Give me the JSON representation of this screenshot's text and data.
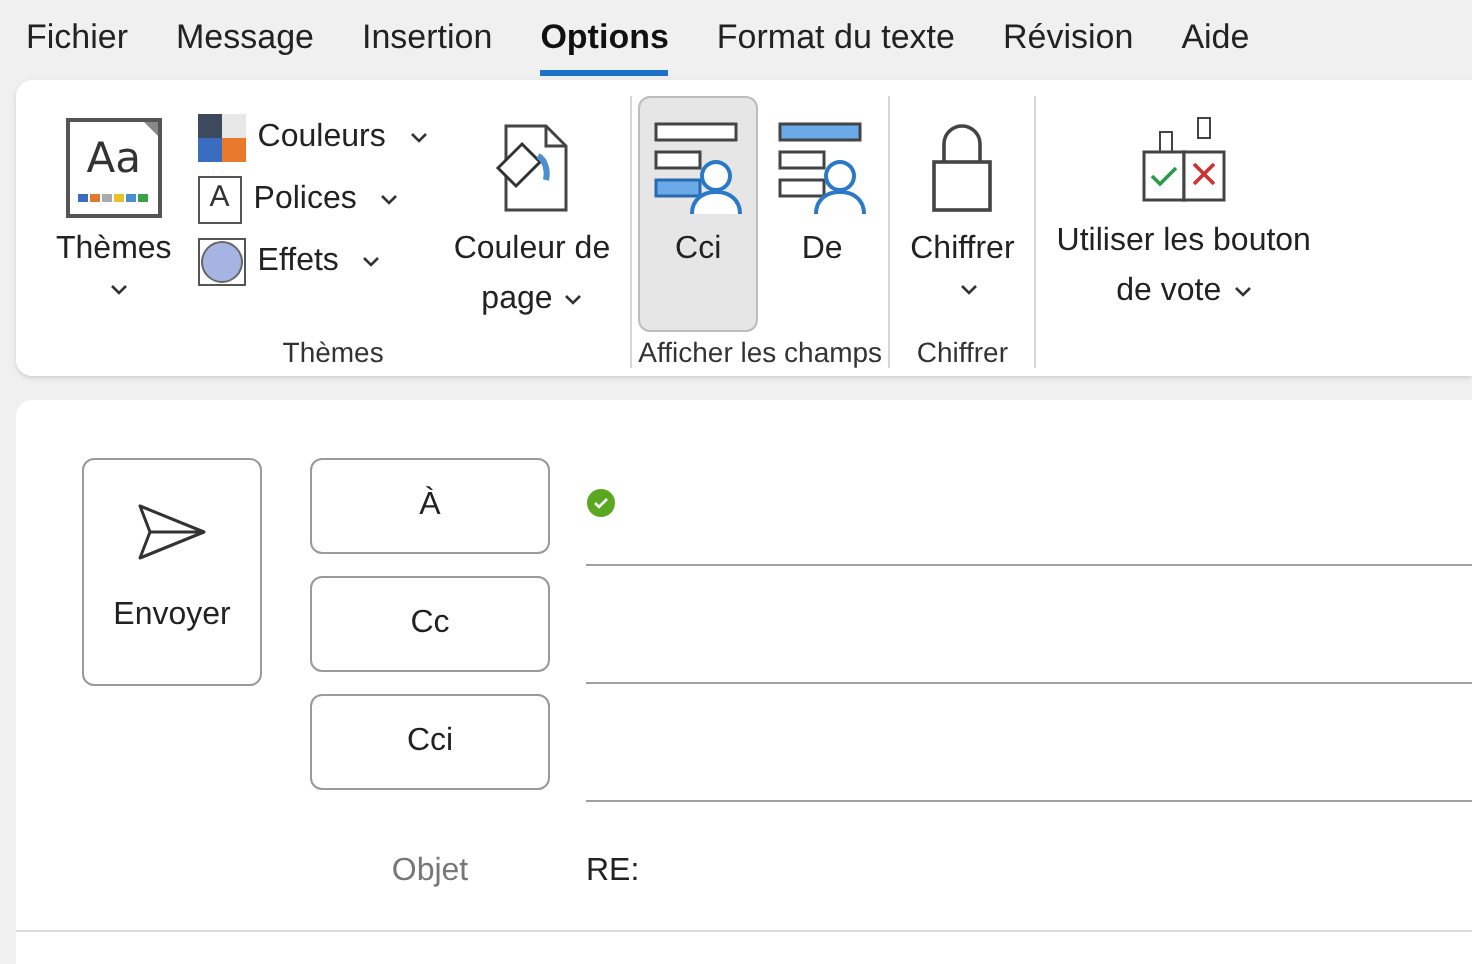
{
  "menu_tabs": [
    {
      "label": "Fichier",
      "selected": false
    },
    {
      "label": "Message",
      "selected": false
    },
    {
      "label": "Insertion",
      "selected": false
    },
    {
      "label": "Options",
      "selected": true
    },
    {
      "label": "Format du texte",
      "selected": false
    },
    {
      "label": "Révision",
      "selected": false
    },
    {
      "label": "Aide",
      "selected": false
    }
  ],
  "ribbon": {
    "groups": [
      {
        "label": "Thèmes",
        "items": [
          {
            "kind": "large",
            "icon_text": "Aa",
            "lines": [
              "Thèmes"
            ],
            "dropdown": true,
            "selected": false
          },
          {
            "kind": "stack",
            "entries": [
              {
                "label": "Couleurs",
                "dropdown": true
              },
              {
                "icon_text": "A",
                "label": "Polices",
                "dropdown": true
              },
              {
                "label": "Effets",
                "dropdown": true
              }
            ]
          },
          {
            "kind": "large",
            "lines": [
              "Couleur de",
              "page"
            ],
            "dropdown": true,
            "selected": false
          }
        ]
      },
      {
        "label": "Afficher les champs",
        "items": [
          {
            "kind": "large",
            "lines": [
              "Cci"
            ],
            "dropdown": false,
            "selected": true
          },
          {
            "kind": "large",
            "lines": [
              "De"
            ],
            "dropdown": false,
            "selected": false
          }
        ]
      },
      {
        "label": "Chiffrer",
        "items": [
          {
            "kind": "large",
            "lines": [
              "Chiffrer"
            ],
            "dropdown": true,
            "selected": false
          }
        ]
      },
      {
        "items": [
          {
            "kind": "large",
            "lines": [
              "Utiliser les bouton",
              "de vote"
            ],
            "dropdown": true,
            "selected": false
          }
        ]
      }
    ]
  },
  "compose": {
    "send_button": "Envoyer",
    "recipients": [
      {
        "label": "À",
        "verified": true
      },
      {
        "label": "Cc",
        "verified": false
      },
      {
        "label": "Cci",
        "verified": false
      }
    ],
    "subject_label": "Objet",
    "subject_value": "RE:"
  }
}
